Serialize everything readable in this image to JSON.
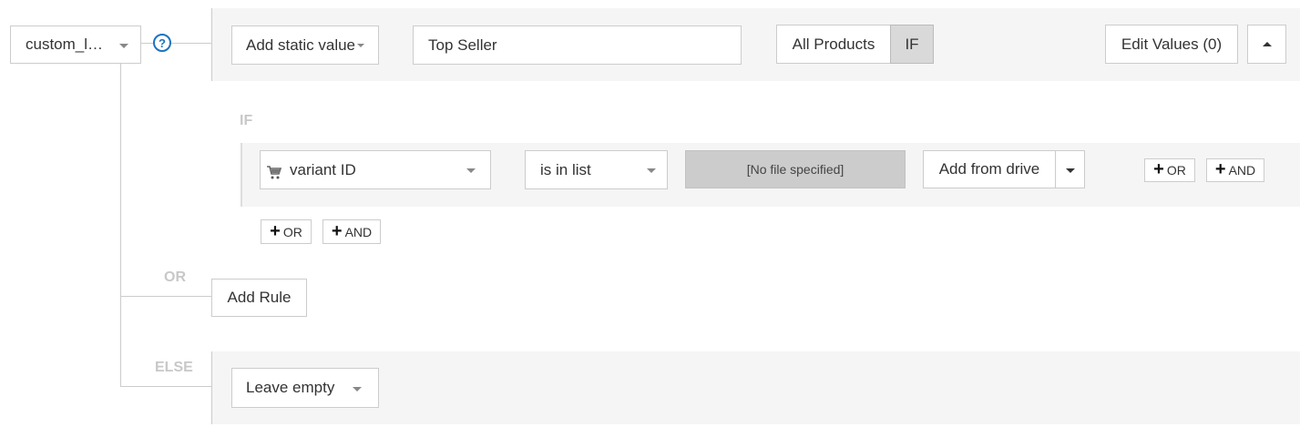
{
  "field_select": {
    "label": "custom_l…"
  },
  "help_icon": "?",
  "header": {
    "value_type_select": "Add static value",
    "value_input": "Top Seller",
    "scope_toggle": {
      "options": [
        "All Products",
        "IF"
      ],
      "selected": "IF"
    },
    "edit_values_label": "Edit Values (0)"
  },
  "if_block": {
    "label": "IF",
    "condition": {
      "attribute_select": "variant ID",
      "operator_select": "is in list",
      "file_status": "[No file specified]",
      "add_from_drive_label": "Add from drive"
    },
    "row_or_label": "OR",
    "row_and_label": "AND",
    "group_or_label": "OR",
    "group_and_label": "AND"
  },
  "or_block": {
    "label": "OR",
    "add_rule_label": "Add Rule"
  },
  "else_block": {
    "label": "ELSE",
    "else_select": "Leave empty"
  },
  "colors": {
    "band_background": "#f5f5f5",
    "border": "#cccccc",
    "help_icon": "#1e73be",
    "disabled_field": "#cccccc",
    "ghost_label": "#c8c8c8"
  }
}
